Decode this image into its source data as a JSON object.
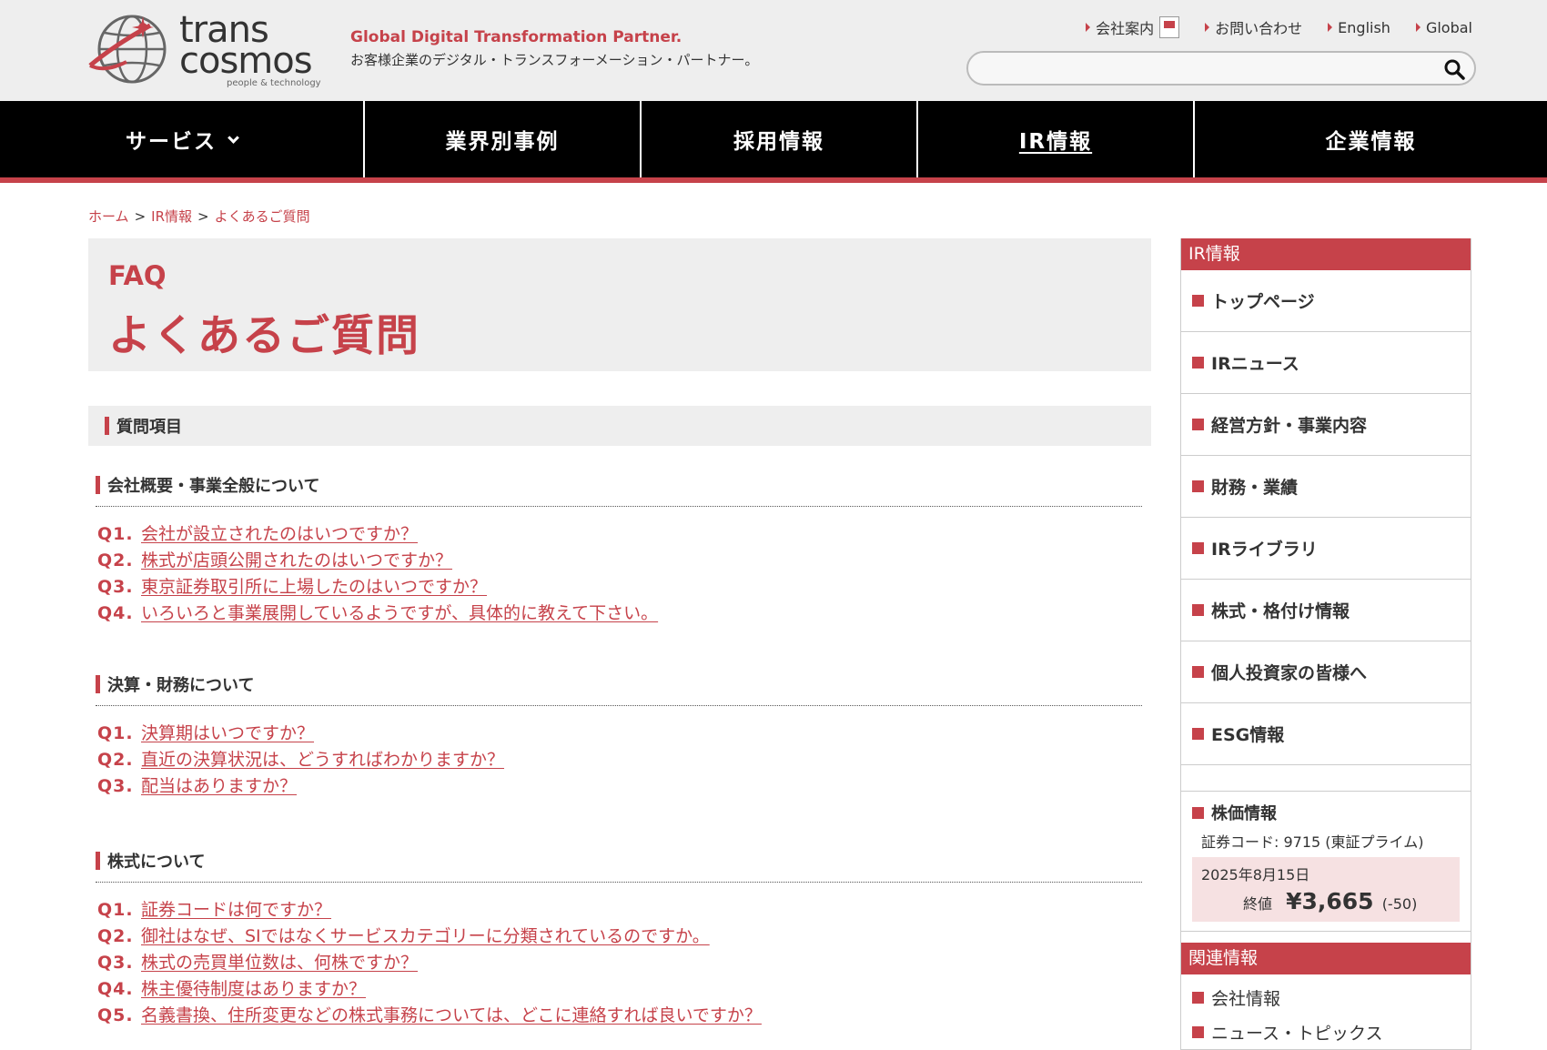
{
  "header": {
    "logo_text_1": "trans",
    "logo_text_2": "cosmos",
    "logo_sub": "people & technology",
    "tagline_en": "Global Digital Transformation Partner.",
    "tagline_jp": "お客様企業のデジタル・トランスフォーメーション・パートナー。",
    "util_links": [
      "会社案内",
      "お問い合わせ",
      "English",
      "Global"
    ],
    "search_placeholder": ""
  },
  "nav": {
    "items": [
      "サービス",
      "業界別事例",
      "採用情報",
      "IR情報",
      "企業情報"
    ],
    "active": "IR情報"
  },
  "breadcrumb": [
    "ホーム",
    "IR情報",
    "よくあるご質問"
  ],
  "hero": {
    "en": "FAQ",
    "jp": "よくあるご質問"
  },
  "section_title": "質問項目",
  "categories": [
    {
      "title": "会社概要・事業全般について",
      "questions": [
        {
          "num": "Q1.",
          "text": "会社が設立されたのはいつですか？"
        },
        {
          "num": "Q2.",
          "text": "株式が店頭公開されたのはいつですか？"
        },
        {
          "num": "Q3.",
          "text": "東京証券取引所に上場したのはいつですか？"
        },
        {
          "num": "Q4.",
          "text": "いろいろと事業展開しているようですが、具体的に教えて下さい。"
        }
      ]
    },
    {
      "title": "決算・財務について",
      "questions": [
        {
          "num": "Q1.",
          "text": "決算期はいつですか？"
        },
        {
          "num": "Q2.",
          "text": "直近の決算状況は、どうすればわかりますか？"
        },
        {
          "num": "Q3.",
          "text": "配当はありますか？"
        }
      ]
    },
    {
      "title": "株式について",
      "questions": [
        {
          "num": "Q1.",
          "text": "証券コードは何ですか？"
        },
        {
          "num": "Q2.",
          "text": "御社はなぜ、SIではなくサービスカテゴリーに分類されているのですか。"
        },
        {
          "num": "Q3.",
          "text": "株式の売買単位数は、何株ですか？"
        },
        {
          "num": "Q4.",
          "text": "株主優待制度はありますか？"
        },
        {
          "num": "Q5.",
          "text": "名義書換、住所変更などの株式事務については、どこに連絡すれば良いですか？"
        }
      ]
    }
  ],
  "sidebar": {
    "title": "IR情報",
    "items": [
      "トップページ",
      "IRニュース",
      "経営方針・事業内容",
      "財務・業績",
      "IRライブラリ",
      "株式・格付け情報",
      "個人投資家の皆様へ",
      "ESG情報"
    ],
    "stock": {
      "title": "株価情報",
      "code": "証券コード: 9715 (東証プライム)",
      "date": "2025年8月15日",
      "close_label": "終値",
      "price": "¥3,665",
      "change": "(-50)"
    },
    "related_title": "関連情報",
    "related": [
      "会社情報",
      "ニュース・トピックス"
    ]
  },
  "colors": {
    "accent": "#c6424a",
    "nav_bg": "#000000",
    "header_bg": "#eeeeee"
  }
}
